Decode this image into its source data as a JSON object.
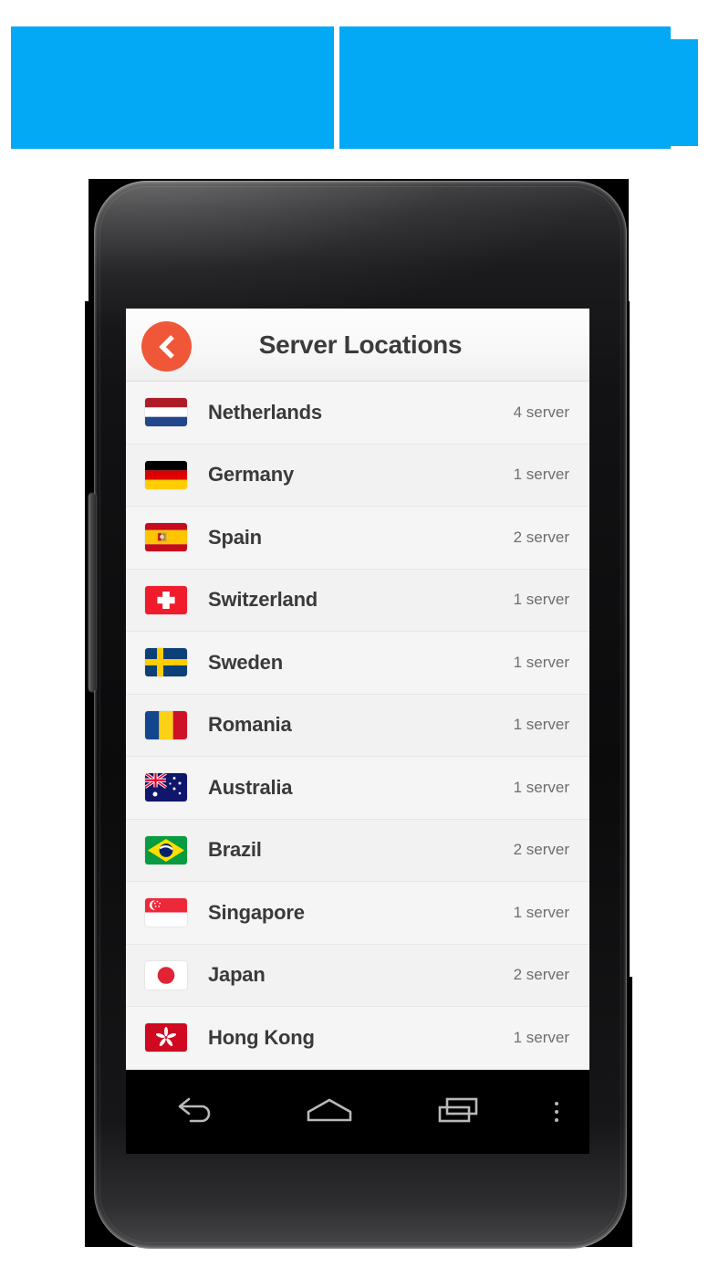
{
  "banners": {
    "color": "#03a9f4",
    "left_label": "",
    "right_label": ""
  },
  "device": {
    "name": "android-phone",
    "body_color": "#121214",
    "screen_bg": "#f5f5f5"
  },
  "app": {
    "appbar": {
      "title": "Server Locations",
      "back_icon": "back-chevron-icon",
      "back_color": "#ef5738"
    },
    "list": [
      {
        "country": "Netherlands",
        "servers": "4 server",
        "flag": "netherlands-flag"
      },
      {
        "country": "Germany",
        "servers": "1 server",
        "flag": "germany-flag"
      },
      {
        "country": "Spain",
        "servers": "2 server",
        "flag": "spain-flag"
      },
      {
        "country": "Switzerland",
        "servers": "1 server",
        "flag": "switzerland-flag"
      },
      {
        "country": "Sweden",
        "servers": "1 server",
        "flag": "sweden-flag"
      },
      {
        "country": "Romania",
        "servers": "1 server",
        "flag": "romania-flag"
      },
      {
        "country": "Australia",
        "servers": "1 server",
        "flag": "australia-flag"
      },
      {
        "country": "Brazil",
        "servers": "2 server",
        "flag": "brazil-flag"
      },
      {
        "country": "Singapore",
        "servers": "1 server",
        "flag": "singapore-flag"
      },
      {
        "country": "Japan",
        "servers": "2 server",
        "flag": "japan-flag"
      },
      {
        "country": "Hong Kong",
        "servers": "1 server",
        "flag": "hongkong-flag"
      }
    ]
  },
  "navbar": {
    "back": "back-arrow-icon",
    "home": "home-icon",
    "recents": "recent-apps-icon",
    "more": "overflow-menu-icon"
  }
}
